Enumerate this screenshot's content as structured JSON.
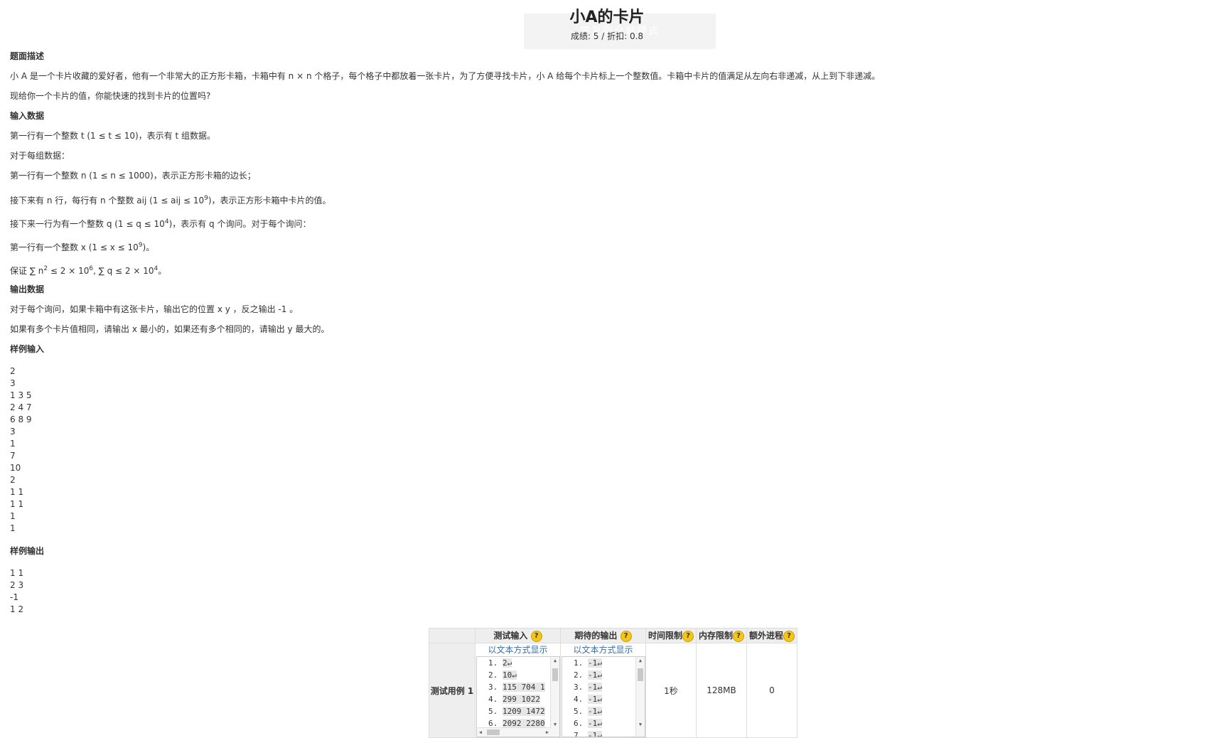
{
  "header": {
    "title": "小A的卡片",
    "subtitle": "成绩: 5 / 折扣: 0.8",
    "ghost_text": "恢复到全屏模式"
  },
  "sections": {
    "desc_title": "题面描述",
    "desc_p1": "小 A 是一个卡片收藏的爱好者，他有一个非常大的正方形卡箱，卡箱中有 n × n 个格子，每个格子中都放着一张卡片，为了方便寻找卡片，小 A 给每个卡片标上一个整数值。卡箱中卡片的值满足从左向右非递减，从上到下非递减。",
    "desc_p2": "现给你一个卡片的值，你能快速的找到卡片的位置吗?",
    "input_title": "输入数据",
    "input_p1": "第一行有一个整数 t (1 ≤ t ≤ 10)，表示有 t 组数据。",
    "input_p2": "对于每组数据：",
    "input_p3": "第一行有一个整数 n (1 ≤ n ≤ 1000)，表示正方形卡箱的边长；",
    "input_p4a": "接下来有 n 行，每行有 n 个整数 aij (1 ≤ aij ≤ 10",
    "input_p4sup": "9",
    "input_p4b": ")，表示正方形卡箱中卡片的值。",
    "input_p5a": "接下来一行为有一个整数 q (1 ≤ q ≤ 10",
    "input_p5sup": "4",
    "input_p5b": ")，表示有 q 个询问。对于每个询问：",
    "input_p6a": "第一行有一个整数 x (1 ≤ x ≤ 10",
    "input_p6sup": "9",
    "input_p6b": ")。",
    "input_p7a": "保证 ∑ n",
    "input_p7sup1": "2",
    "input_p7b": " ≤ 2 × 10",
    "input_p7sup2": "6",
    "input_p7c": ", ∑ q ≤ 2 × 10",
    "input_p7sup3": "4",
    "input_p7d": "。",
    "output_title": "输出数据",
    "output_p1": "对于每个询问，如果卡箱中有这张卡片，输出它的位置 x y ，反之输出 -1 。",
    "output_p2": "如果有多个卡片值相同，请输出 x 最小的，如果还有多个相同的，请输出 y 最大的。",
    "sample_in_title": "样例输入",
    "sample_in": [
      "2",
      "3",
      "1 3 5",
      "2 4 7",
      "6 8 9",
      "3",
      "1",
      "7",
      "10",
      "2",
      "1 1",
      "1 1",
      "1",
      "1"
    ],
    "sample_out_title": "样例输出",
    "sample_out": [
      "1 1",
      "2 3",
      "-1",
      "1 2"
    ]
  },
  "tests": {
    "headers": {
      "input": "测试输入",
      "expected": "期待的输出",
      "time": "时间限制",
      "memory": "内存限制",
      "extra": "额外进程",
      "help": "?"
    },
    "row_label": "测试用例 1",
    "show_text": "以文本方式显示",
    "input_lines": [
      {
        "num": "1.",
        "val": "2↵"
      },
      {
        "num": "2.",
        "val": "10↵"
      },
      {
        "num": "3.",
        "val": "115 704 1"
      },
      {
        "num": "4.",
        "val": "299 1022"
      },
      {
        "num": "5.",
        "val": "1209 1472"
      },
      {
        "num": "6.",
        "val": "2092 2280"
      }
    ],
    "expected_lines": [
      {
        "num": "1.",
        "val": "-1↵"
      },
      {
        "num": "2.",
        "val": "-1↵"
      },
      {
        "num": "3.",
        "val": "-1↵"
      },
      {
        "num": "4.",
        "val": "-1↵"
      },
      {
        "num": "5.",
        "val": "-1↵"
      },
      {
        "num": "6.",
        "val": "-1↵"
      },
      {
        "num": "7.",
        "val": "-1↵"
      }
    ],
    "time": "1秒",
    "memory": "128MB",
    "extra": "0"
  }
}
